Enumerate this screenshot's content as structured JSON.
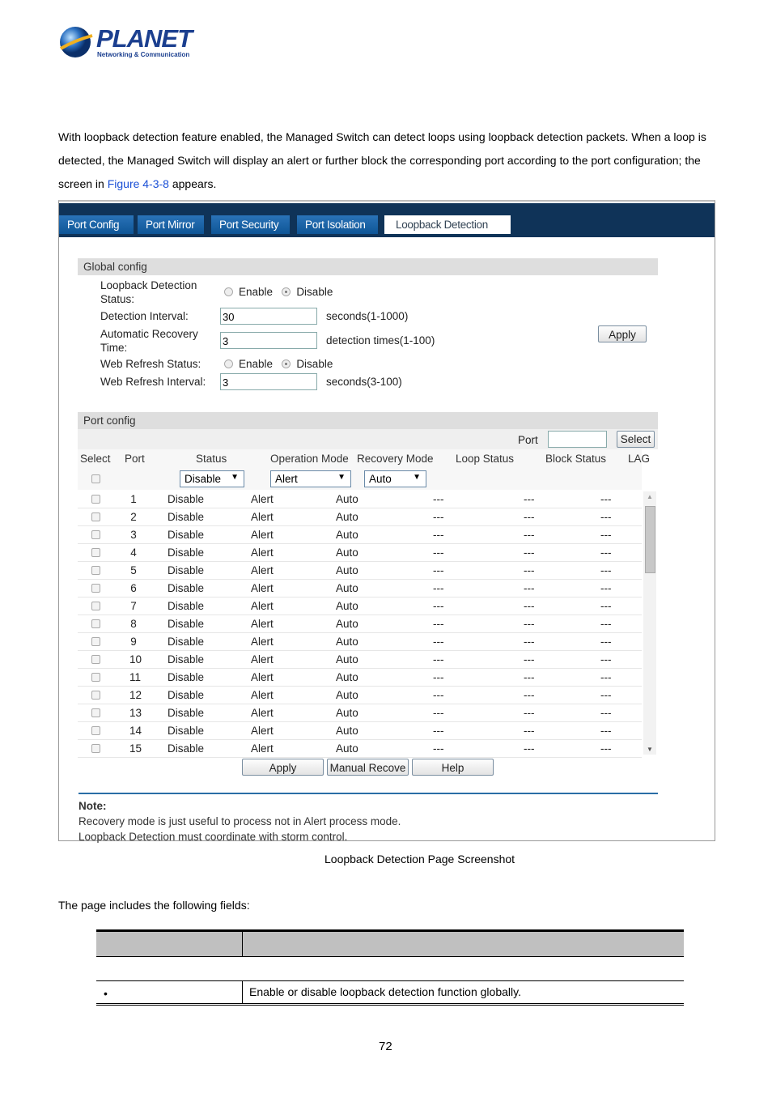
{
  "logo": {
    "brand": "PLANET",
    "tagline": "Networking & Communication"
  },
  "intro": {
    "text_before": "With loopback detection feature enabled, the Managed Switch can detect loops using loopback detection packets. When a loop is detected, the Managed Switch will display an alert or further block the corresponding port according to the port configuration; the screen in ",
    "link": "Figure 4-3-8",
    "text_after": " appears."
  },
  "tabs": [
    {
      "label": "Port Config"
    },
    {
      "label": "Port Mirror"
    },
    {
      "label": "Port Security"
    },
    {
      "label": "Port Isolation"
    },
    {
      "label": "Loopback Detection",
      "active": true
    }
  ],
  "global": {
    "title": "Global config",
    "loop_status_label": "Loopback Detection Status:",
    "enable": "Enable",
    "disable": "Disable",
    "loop_status": "Disable",
    "interval_label": "Detection Interval:",
    "interval_value": "30",
    "interval_hint": "seconds(1-1000)",
    "recovery_label": "Automatic Recovery Time:",
    "recovery_value": "3",
    "recovery_hint": "detection times(1-100)",
    "web_status_label": "Web Refresh Status:",
    "web_status": "Disable",
    "web_interval_label": "Web Refresh Interval:",
    "web_interval_value": "3",
    "web_interval_hint": "seconds(3-100)",
    "apply": "Apply"
  },
  "port": {
    "title": "Port config",
    "port_label": "Port",
    "port_value": "",
    "select_btn": "Select",
    "headers": [
      "Select",
      "Port",
      "Status",
      "Operation Mode",
      "Recovery Mode",
      "Loop Status",
      "Block Status",
      "LAG"
    ],
    "filter": {
      "status": "Disable",
      "operation": "Alert",
      "recovery": "Auto"
    },
    "rows": [
      {
        "port": "1",
        "status": "Disable",
        "op": "Alert",
        "rec": "Auto",
        "loop": "---",
        "block": "---",
        "lag": "---"
      },
      {
        "port": "2",
        "status": "Disable",
        "op": "Alert",
        "rec": "Auto",
        "loop": "---",
        "block": "---",
        "lag": "---"
      },
      {
        "port": "3",
        "status": "Disable",
        "op": "Alert",
        "rec": "Auto",
        "loop": "---",
        "block": "---",
        "lag": "---"
      },
      {
        "port": "4",
        "status": "Disable",
        "op": "Alert",
        "rec": "Auto",
        "loop": "---",
        "block": "---",
        "lag": "---"
      },
      {
        "port": "5",
        "status": "Disable",
        "op": "Alert",
        "rec": "Auto",
        "loop": "---",
        "block": "---",
        "lag": "---"
      },
      {
        "port": "6",
        "status": "Disable",
        "op": "Alert",
        "rec": "Auto",
        "loop": "---",
        "block": "---",
        "lag": "---"
      },
      {
        "port": "7",
        "status": "Disable",
        "op": "Alert",
        "rec": "Auto",
        "loop": "---",
        "block": "---",
        "lag": "---"
      },
      {
        "port": "8",
        "status": "Disable",
        "op": "Alert",
        "rec": "Auto",
        "loop": "---",
        "block": "---",
        "lag": "---"
      },
      {
        "port": "9",
        "status": "Disable",
        "op": "Alert",
        "rec": "Auto",
        "loop": "---",
        "block": "---",
        "lag": "---"
      },
      {
        "port": "10",
        "status": "Disable",
        "op": "Alert",
        "rec": "Auto",
        "loop": "---",
        "block": "---",
        "lag": "---"
      },
      {
        "port": "11",
        "status": "Disable",
        "op": "Alert",
        "rec": "Auto",
        "loop": "---",
        "block": "---",
        "lag": "---"
      },
      {
        "port": "12",
        "status": "Disable",
        "op": "Alert",
        "rec": "Auto",
        "loop": "---",
        "block": "---",
        "lag": "---"
      },
      {
        "port": "13",
        "status": "Disable",
        "op": "Alert",
        "rec": "Auto",
        "loop": "---",
        "block": "---",
        "lag": "---"
      },
      {
        "port": "14",
        "status": "Disable",
        "op": "Alert",
        "rec": "Auto",
        "loop": "---",
        "block": "---",
        "lag": "---"
      },
      {
        "port": "15",
        "status": "Disable",
        "op": "Alert",
        "rec": "Auto",
        "loop": "---",
        "block": "---",
        "lag": "---"
      }
    ],
    "apply": "Apply",
    "manual": "Manual Recove",
    "help": "Help"
  },
  "note": {
    "title": "Note:",
    "lines": [
      "Recovery mode is just useful to process not in Alert process mode.",
      "Loopback Detection must coordinate with storm control."
    ]
  },
  "caption": "Loopback Detection Page Screenshot",
  "fields_intro": "The page includes the following fields:",
  "fields_table": {
    "row_desc": "Enable or disable loopback detection function globally.",
    "bullet": "•"
  },
  "page_number": "72"
}
